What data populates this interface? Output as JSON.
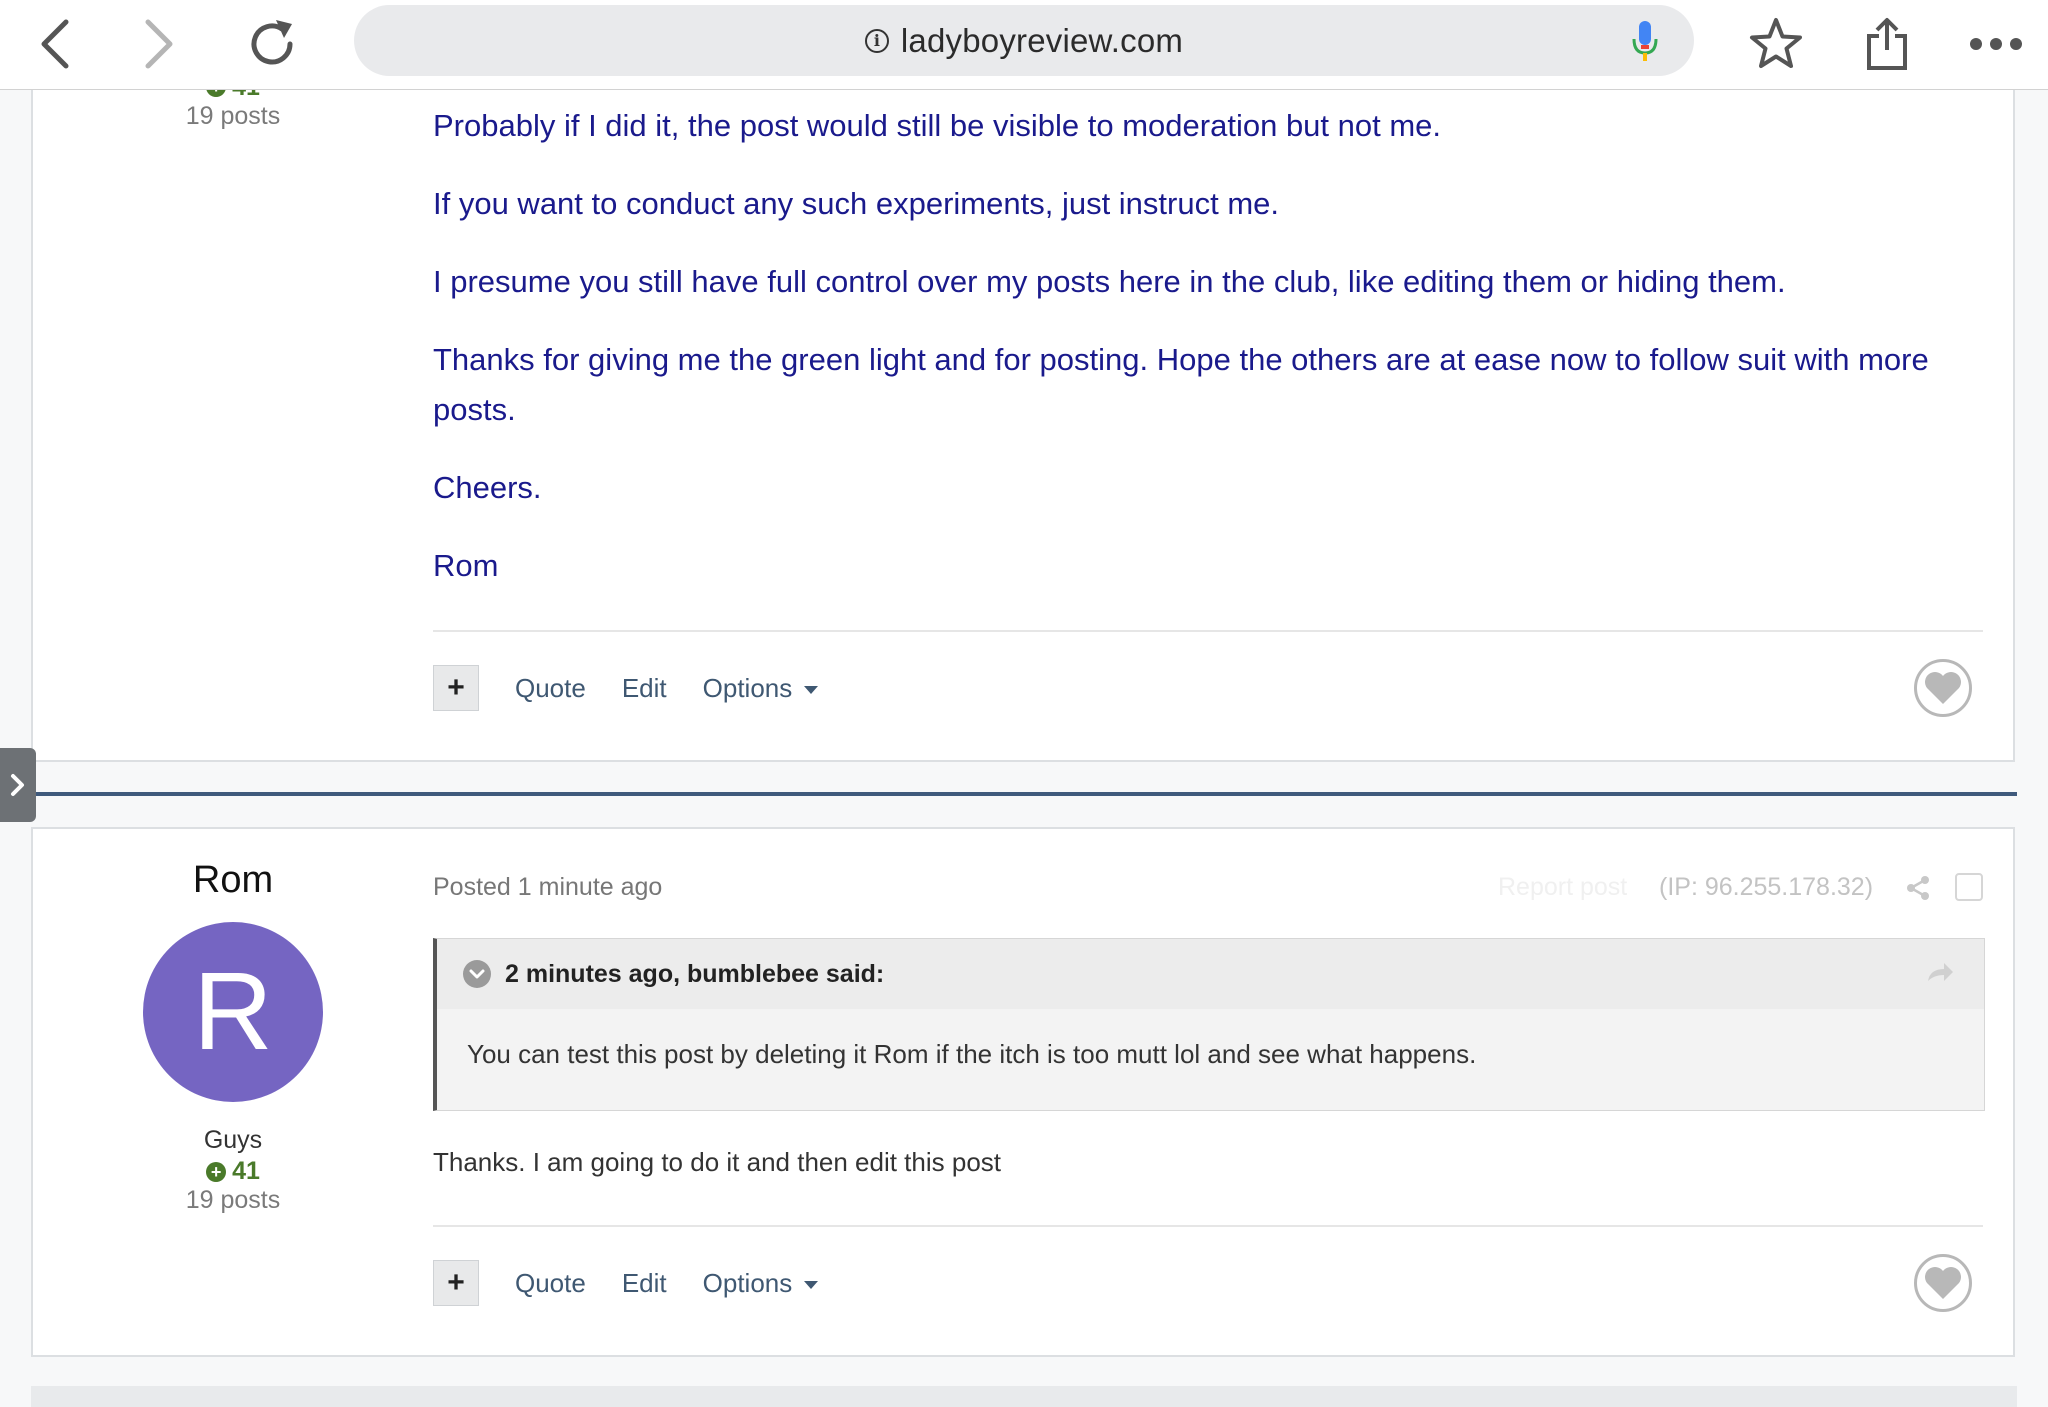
{
  "browser": {
    "url": "ladyboyreview.com"
  },
  "post1": {
    "rep": "41",
    "posts": "19 posts",
    "paragraphs": [
      "Probably if I did it, the post would still be visible to moderation but not me.",
      "If you want to conduct any such experiments, just instruct me.",
      "I presume you still have full control over my posts here in the club, like editing them or hiding them.",
      "Thanks for giving me the green light and for posting.  Hope the others are at ease now to follow suit with more posts.",
      "Cheers.",
      "Rom"
    ],
    "actions": {
      "plus": "+",
      "quote": "Quote",
      "edit": "Edit",
      "options": "Options"
    }
  },
  "post2": {
    "author": "Rom",
    "avatar_letter": "R",
    "group": "Guys",
    "rep": "41",
    "posts": "19 posts",
    "posted": "Posted 1 minute ago",
    "report": "Report post",
    "ip": "(IP: 96.255.178.32)",
    "quote_header": "2 minutes ago, bumblebee said:",
    "quote_text": "You can test this post by deleting it Rom if the itch is too mutt lol and see what happens.",
    "reply": "Thanks.  I am going to do it and then edit this post",
    "actions": {
      "plus": "+",
      "quote": "Quote",
      "edit": "Edit",
      "options": "Options"
    }
  },
  "colors": {
    "body_text": "#1a1a8c",
    "avatar_bg": "#7565c2",
    "rep_green": "#4a7a2a",
    "link": "#3f5872",
    "separator": "#3f5a7c"
  }
}
